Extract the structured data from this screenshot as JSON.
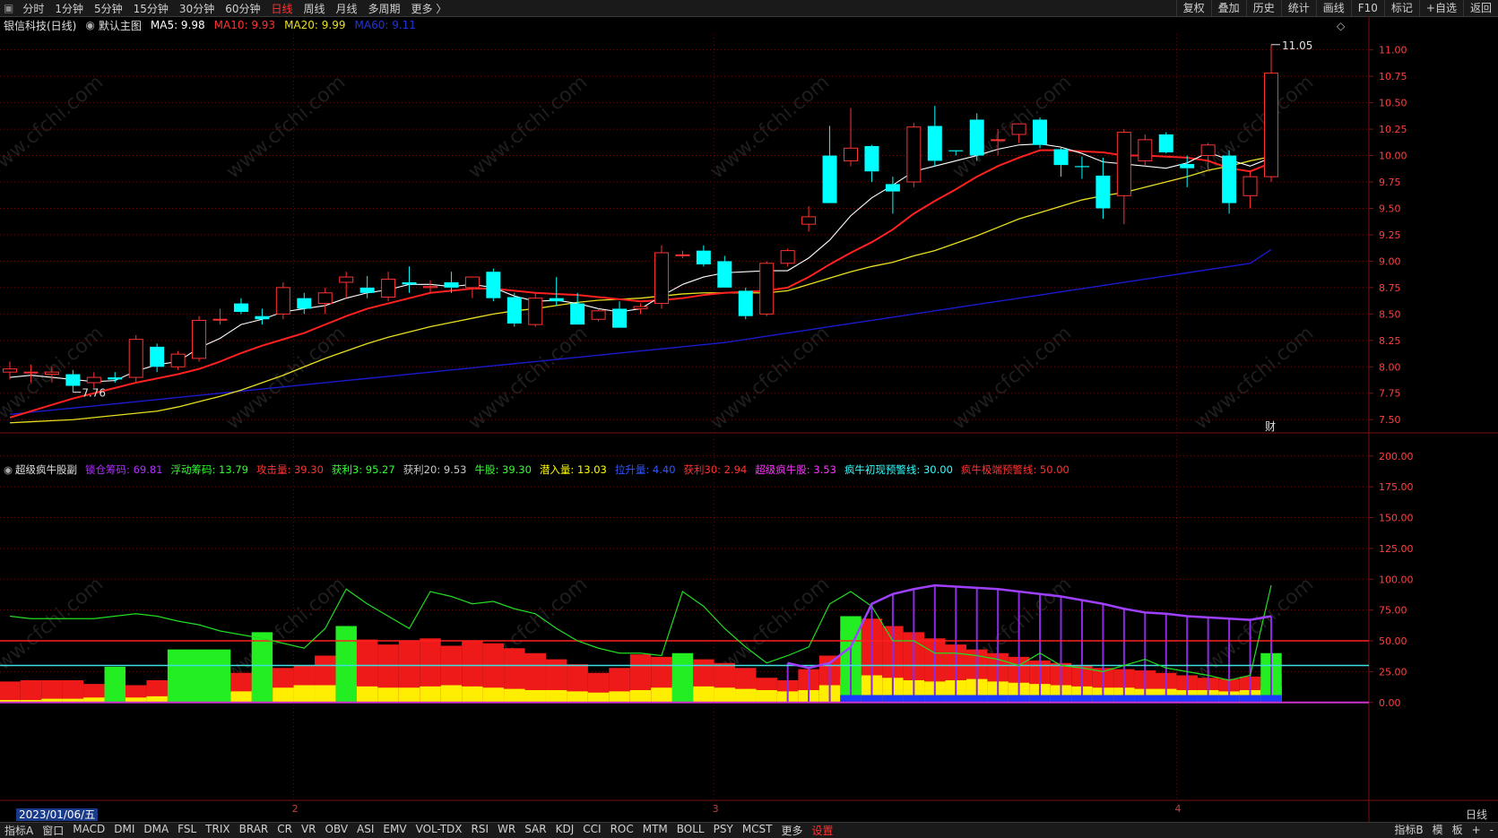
{
  "topbar": {
    "tabs": [
      "分时",
      "1分钟",
      "5分钟",
      "15分钟",
      "30分钟",
      "60分钟",
      "日线",
      "周线",
      "月线",
      "多周期",
      "更多 〉"
    ],
    "active_tab": "日线",
    "right_tools": [
      "复权",
      "叠加",
      "历史",
      "统计",
      "画线",
      "F10",
      "标记",
      "+自选",
      "返回"
    ]
  },
  "main_info": {
    "stock": "银信科技(日线)",
    "chart_name": "默认主图",
    "ma5": "MA5: 9.98",
    "ma10": "MA10: 9.93",
    "ma20": "MA20: 9.99",
    "ma60": "MA60: 9.11"
  },
  "indicator_info": {
    "name": "超级疯牛股副",
    "items": [
      {
        "text": "锁仓筹码: 69.81",
        "color": "#b030ff"
      },
      {
        "text": "浮动筹码: 13.79",
        "color": "#33ff33"
      },
      {
        "text": "攻击量: 39.30",
        "color": "#ff3333"
      },
      {
        "text": "获利3: 95.27",
        "color": "#33ff33"
      },
      {
        "text": "获利20: 9.53",
        "color": "#c8c8c8"
      },
      {
        "text": "牛股: 39.30",
        "color": "#33ff33"
      },
      {
        "text": "潜入量: 13.03",
        "color": "#ffff00"
      },
      {
        "text": "拉升量: 4.40",
        "color": "#3355ff"
      },
      {
        "text": "获利30: 2.94",
        "color": "#ff3333"
      },
      {
        "text": "超级疯牛股: 3.53",
        "color": "#ff33ff"
      },
      {
        "text": "疯牛初现预警线: 30.00",
        "color": "#33ffff"
      },
      {
        "text": "疯牛极端预警线: 50.00",
        "color": "#ff3333"
      }
    ]
  },
  "bottombar": {
    "indicators": [
      "指标A",
      "窗口",
      "MACD",
      "DMI",
      "DMA",
      "FSL",
      "TRIX",
      "BRAR",
      "CR",
      "VR",
      "OBV",
      "ASI",
      "EMV",
      "VOL-TDX",
      "RSI",
      "WR",
      "SAR",
      "KDJ",
      "CCI",
      "ROC",
      "MTM",
      "BOLL",
      "PSY",
      "MCST",
      "更多",
      "设置"
    ],
    "right": [
      "指标B",
      "模",
      "板",
      "+",
      "-"
    ]
  },
  "date_label": "2023/01/06/五",
  "period_label": "日线",
  "month_marks": [
    "2",
    "3",
    "4"
  ],
  "annotations": {
    "high": "11.05",
    "low": "7.76",
    "fin_marker": "财"
  },
  "watermark": "www.cfchi.com",
  "colors": {
    "up": "#ff3333",
    "down": "#00ffff",
    "ma5": "#ffffff",
    "ma10": "#ff2020",
    "ma20": "#e8e020",
    "ma60": "#1a1acc"
  },
  "chart_data": [
    {
      "type": "candlestick",
      "title": "银信科技(日线)",
      "y_ticks": [
        "11.00",
        "10.75",
        "10.50",
        "10.25",
        "10.00",
        "9.75",
        "9.50",
        "9.25",
        "9.00",
        "8.75",
        "8.50",
        "8.25",
        "8.00",
        "7.75",
        "7.50"
      ],
      "ylim": [
        7.4,
        11.15
      ],
      "ohlc": [
        [
          7.95,
          8.05,
          7.88,
          7.98
        ],
        [
          7.95,
          8.02,
          7.85,
          7.95
        ],
        [
          7.93,
          8.0,
          7.85,
          7.95
        ],
        [
          7.93,
          7.97,
          7.76,
          7.82
        ],
        [
          7.85,
          7.95,
          7.8,
          7.9
        ],
        [
          7.9,
          7.95,
          7.85,
          7.88
        ],
        [
          7.9,
          8.3,
          7.85,
          8.26
        ],
        [
          8.19,
          8.22,
          7.95,
          8.0
        ],
        [
          8.0,
          8.15,
          7.97,
          8.12
        ],
        [
          8.08,
          8.48,
          8.05,
          8.44
        ],
        [
          8.45,
          8.55,
          8.4,
          8.45
        ],
        [
          8.6,
          8.65,
          8.5,
          8.52
        ],
        [
          8.48,
          8.55,
          8.4,
          8.45
        ],
        [
          8.5,
          8.8,
          8.45,
          8.75
        ],
        [
          8.65,
          8.7,
          8.5,
          8.55
        ],
        [
          8.6,
          8.75,
          8.5,
          8.7
        ],
        [
          8.8,
          8.9,
          8.65,
          8.85
        ],
        [
          8.75,
          8.86,
          8.65,
          8.7
        ],
        [
          8.66,
          8.9,
          8.62,
          8.83
        ],
        [
          8.8,
          8.95,
          8.7,
          8.78
        ],
        [
          8.75,
          8.82,
          8.7,
          8.76
        ],
        [
          8.8,
          8.9,
          8.7,
          8.75
        ],
        [
          8.75,
          8.85,
          8.65,
          8.85
        ],
        [
          8.9,
          8.93,
          8.62,
          8.65
        ],
        [
          8.66,
          8.7,
          8.38,
          8.41
        ],
        [
          8.4,
          8.7,
          8.38,
          8.65
        ],
        [
          8.65,
          8.85,
          8.58,
          8.62
        ],
        [
          8.6,
          8.7,
          8.4,
          8.4
        ],
        [
          8.45,
          8.55,
          8.43,
          8.53
        ],
        [
          8.55,
          8.62,
          8.37,
          8.37
        ],
        [
          8.55,
          8.6,
          8.5,
          8.57
        ],
        [
          8.6,
          9.15,
          8.55,
          9.08
        ],
        [
          9.06,
          9.1,
          9.03,
          9.06
        ],
        [
          9.1,
          9.15,
          8.95,
          8.97
        ],
        [
          9.0,
          9.05,
          8.75,
          8.75
        ],
        [
          8.72,
          8.75,
          8.45,
          8.48
        ],
        [
          8.5,
          9.0,
          8.48,
          8.98
        ],
        [
          8.98,
          9.12,
          8.95,
          9.1
        ],
        [
          9.35,
          9.52,
          9.28,
          9.42
        ],
        [
          10.0,
          10.28,
          9.6,
          9.55
        ],
        [
          9.95,
          10.45,
          9.9,
          10.07
        ],
        [
          10.09,
          10.1,
          9.75,
          9.85
        ],
        [
          9.73,
          9.8,
          9.45,
          9.66
        ],
        [
          9.75,
          10.31,
          9.7,
          10.27
        ],
        [
          10.28,
          10.47,
          9.9,
          9.95
        ],
        [
          10.05,
          10.05,
          10.0,
          10.04
        ],
        [
          10.34,
          10.4,
          9.95,
          10.0
        ],
        [
          10.15,
          10.25,
          10.0,
          10.15
        ],
        [
          10.2,
          10.3,
          10.12,
          10.3
        ],
        [
          10.34,
          10.36,
          10.07,
          10.1
        ],
        [
          10.06,
          10.08,
          9.8,
          9.91
        ],
        [
          9.9,
          9.99,
          9.78,
          9.89
        ],
        [
          9.81,
          9.98,
          9.4,
          9.5
        ],
        [
          9.62,
          10.25,
          9.35,
          10.22
        ],
        [
          9.95,
          10.2,
          9.9,
          10.15
        ],
        [
          10.2,
          10.22,
          10.02,
          10.03
        ],
        [
          9.92,
          10.0,
          9.7,
          9.88
        ],
        [
          10.0,
          10.12,
          9.85,
          10.1
        ],
        [
          10.0,
          10.05,
          9.45,
          9.55
        ],
        [
          9.62,
          9.85,
          9.5,
          9.8
        ],
        [
          9.8,
          11.05,
          9.75,
          10.78
        ]
      ],
      "ma5": [
        7.9,
        7.92,
        7.9,
        7.88,
        7.86,
        7.87,
        7.96,
        8.02,
        8.05,
        8.18,
        8.27,
        8.4,
        8.45,
        8.52,
        8.55,
        8.58,
        8.65,
        8.7,
        8.73,
        8.78,
        8.78,
        8.76,
        8.78,
        8.75,
        8.67,
        8.62,
        8.63,
        8.6,
        8.55,
        8.52,
        8.55,
        8.67,
        8.78,
        8.85,
        8.89,
        8.9,
        8.91,
        8.91,
        9.03,
        9.2,
        9.43,
        9.6,
        9.72,
        9.85,
        9.9,
        9.95,
        10.0,
        10.06,
        10.1,
        10.11,
        10.08,
        10.02,
        9.94,
        9.92,
        9.9,
        9.88,
        9.93,
        10.03,
        9.96,
        9.9,
        9.98
      ],
      "ma10": [
        7.52,
        7.58,
        7.64,
        7.7,
        7.75,
        7.8,
        7.85,
        7.89,
        7.93,
        7.98,
        8.05,
        8.13,
        8.2,
        8.26,
        8.32,
        8.4,
        8.48,
        8.55,
        8.6,
        8.65,
        8.7,
        8.72,
        8.74,
        8.74,
        8.72,
        8.7,
        8.69,
        8.68,
        8.66,
        8.64,
        8.62,
        8.63,
        8.65,
        8.68,
        8.7,
        8.71,
        8.72,
        8.75,
        8.85,
        8.97,
        9.08,
        9.18,
        9.3,
        9.45,
        9.57,
        9.68,
        9.8,
        9.9,
        9.98,
        10.05,
        10.05,
        10.04,
        10.03,
        10.0,
        10.0,
        9.99,
        9.98,
        9.95,
        9.88,
        9.85,
        9.93
      ],
      "ma20": [
        7.47,
        7.48,
        7.49,
        7.5,
        7.52,
        7.54,
        7.56,
        7.58,
        7.62,
        7.67,
        7.72,
        7.78,
        7.85,
        7.92,
        8.0,
        8.08,
        8.15,
        8.22,
        8.28,
        8.33,
        8.38,
        8.42,
        8.46,
        8.5,
        8.53,
        8.55,
        8.58,
        8.61,
        8.63,
        8.64,
        8.65,
        8.67,
        8.69,
        8.7,
        8.7,
        8.7,
        8.7,
        8.72,
        8.78,
        8.84,
        8.9,
        8.95,
        8.99,
        9.05,
        9.1,
        9.17,
        9.24,
        9.32,
        9.4,
        9.46,
        9.52,
        9.58,
        9.62,
        9.65,
        9.7,
        9.75,
        9.8,
        9.86,
        9.9,
        9.95,
        9.99
      ],
      "ma60": [
        7.55,
        7.57,
        7.59,
        7.61,
        7.63,
        7.65,
        7.67,
        7.69,
        7.71,
        7.73,
        7.75,
        7.77,
        7.79,
        7.81,
        7.83,
        7.85,
        7.87,
        7.89,
        7.91,
        7.93,
        7.95,
        7.97,
        7.99,
        8.01,
        8.03,
        8.05,
        8.07,
        8.09,
        8.11,
        8.13,
        8.15,
        8.17,
        8.19,
        8.21,
        8.23,
        8.26,
        8.29,
        8.32,
        8.35,
        8.38,
        8.41,
        8.44,
        8.47,
        8.5,
        8.53,
        8.56,
        8.59,
        8.62,
        8.65,
        8.68,
        8.71,
        8.74,
        8.77,
        8.8,
        8.83,
        8.86,
        8.89,
        8.92,
        8.95,
        8.98,
        9.11
      ]
    },
    {
      "type": "bar",
      "title": "超级疯牛股副",
      "y_ticks": [
        "200.00",
        "175.00",
        "150.00",
        "125.00",
        "100.00",
        "75.00",
        "50.00",
        "25.00",
        "0.00"
      ],
      "ylim": [
        -70,
        210
      ],
      "reference_lines": [
        50,
        30
      ],
      "red": [
        17,
        18,
        18,
        18,
        15,
        12,
        14,
        18,
        16,
        20,
        22,
        24,
        24,
        28,
        30,
        38,
        46,
        51,
        47,
        50,
        52,
        46,
        50,
        48,
        44,
        40,
        35,
        31,
        24,
        28,
        39,
        37,
        36,
        35,
        32,
        28,
        20,
        18,
        27,
        38,
        58,
        68,
        62,
        57,
        52,
        47,
        43,
        40,
        37,
        34,
        32,
        30,
        28,
        27,
        26,
        24,
        22,
        20,
        19,
        21,
        23
      ],
      "yellow": [
        2,
        2,
        3,
        3,
        4,
        4,
        4,
        5,
        6,
        7,
        8,
        9,
        10,
        12,
        14,
        14,
        14,
        13,
        12,
        12,
        13,
        14,
        13,
        12,
        11,
        10,
        10,
        9,
        8,
        9,
        10,
        12,
        14,
        13,
        12,
        11,
        10,
        9,
        10,
        14,
        20,
        22,
        20,
        18,
        17,
        18,
        19,
        17,
        16,
        15,
        14,
        13,
        12,
        12,
        11,
        11,
        10,
        10,
        9,
        10,
        13
      ],
      "green_overlay": [
        0,
        0,
        0,
        0,
        0,
        29,
        0,
        0,
        43,
        43,
        43,
        0,
        57,
        0,
        0,
        0,
        62,
        0,
        0,
        0,
        0,
        0,
        0,
        0,
        0,
        0,
        0,
        0,
        0,
        0,
        0,
        0,
        40,
        0,
        0,
        0,
        0,
        0,
        0,
        0,
        70,
        0,
        0,
        0,
        0,
        0,
        0,
        0,
        0,
        0,
        0,
        0,
        0,
        0,
        0,
        0,
        0,
        0,
        0,
        0,
        40
      ],
      "green_line": [
        70,
        68,
        68,
        68,
        68,
        70,
        72,
        70,
        66,
        63,
        58,
        55,
        52,
        48,
        44,
        60,
        92,
        80,
        70,
        60,
        90,
        86,
        80,
        82,
        76,
        72,
        60,
        50,
        44,
        40,
        40,
        38,
        90,
        78,
        60,
        45,
        32,
        38,
        45,
        80,
        90,
        78,
        50,
        50,
        40,
        40,
        38,
        35,
        30,
        40,
        30,
        28,
        25,
        30,
        35,
        28,
        25,
        22,
        18,
        22,
        95
      ],
      "purple_line": [
        0,
        0,
        0,
        0,
        0,
        0,
        0,
        0,
        0,
        0,
        0,
        0,
        0,
        0,
        0,
        0,
        0,
        0,
        0,
        0,
        0,
        0,
        0,
        0,
        0,
        0,
        0,
        0,
        0,
        0,
        0,
        0,
        0,
        0,
        0,
        0,
        0,
        32,
        28,
        32,
        45,
        80,
        88,
        92,
        95,
        94,
        93,
        92,
        90,
        88,
        86,
        83,
        80,
        76,
        73,
        72,
        70,
        69,
        68,
        67,
        70
      ]
    }
  ]
}
